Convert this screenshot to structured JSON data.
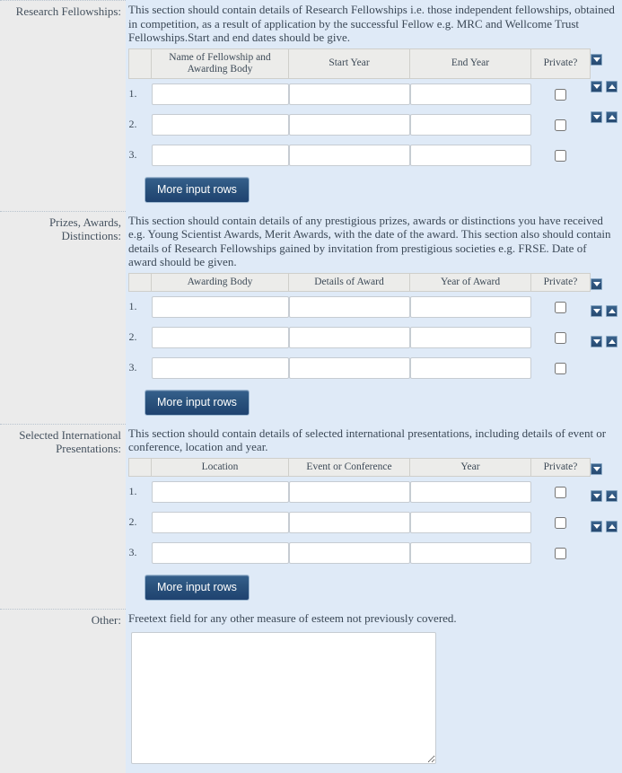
{
  "page": {
    "background_color": "#dfeaf7",
    "label_column_color": "#ebebeb",
    "accent_color": "#2a527c"
  },
  "sections": [
    {
      "label": "Research Fellowships:",
      "helptext": "This section should contain details of Research Fellowships i.e. those independent fellowships, obtained in competition, as a result of application by the successful Fellow e.g. MRC and Wellcome Trust Fellowships.Start and end dates should be give.",
      "columns": [
        "",
        "Name of Fellowship and Awarding Body",
        "Start Year",
        "End Year",
        "Private?"
      ],
      "rows": [
        {
          "num": "1.",
          "a": "",
          "b": "",
          "c": "",
          "private": false
        },
        {
          "num": "2.",
          "a": "",
          "b": "",
          "c": "",
          "private": false
        },
        {
          "num": "3.",
          "a": "",
          "b": "",
          "c": "",
          "private": false
        }
      ],
      "more_button": "More input rows"
    },
    {
      "label": "Prizes, Awards, Distinctions:",
      "helptext": "This section should contain details of any prestigious prizes, awards or distinctions you have received e.g. Young Scientist Awards, Merit Awards, with the date of the award. This section also should contain details of Research Fellowships gained by invitation from prestigious societies e.g. FRSE. Date of award should be given.",
      "columns": [
        "",
        "Awarding Body",
        "Details of Award",
        "Year of Award",
        "Private?"
      ],
      "rows": [
        {
          "num": "1.",
          "a": "",
          "b": "",
          "c": "",
          "private": false
        },
        {
          "num": "2.",
          "a": "",
          "b": "",
          "c": "",
          "private": false
        },
        {
          "num": "3.",
          "a": "",
          "b": "",
          "c": "",
          "private": false
        }
      ],
      "more_button": "More input rows"
    },
    {
      "label": "Selected International Presentations:",
      "helptext": "This section should contain details of selected international presentations, including details of event or conference, location and year.",
      "columns": [
        "",
        "Location",
        "Event or Conference",
        "Year",
        "Private?"
      ],
      "rows": [
        {
          "num": "1.",
          "a": "",
          "b": "",
          "c": "",
          "private": false
        },
        {
          "num": "2.",
          "a": "",
          "b": "",
          "c": "",
          "private": false
        },
        {
          "num": "3.",
          "a": "",
          "b": "",
          "c": "",
          "private": false
        }
      ],
      "more_button": "More input rows"
    }
  ],
  "other": {
    "label": "Other:",
    "helptext": "Freetext field for any other measure of esteem not previously covered.",
    "value": "",
    "placeholder": ""
  },
  "icons": {
    "move_down": "triangle-down-icon",
    "move_up": "triangle-up-icon"
  }
}
